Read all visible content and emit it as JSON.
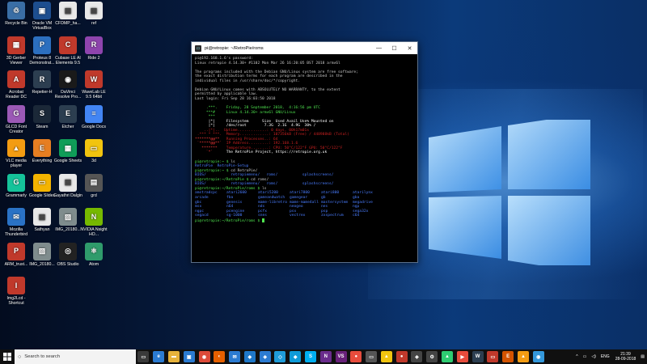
{
  "desktop_icons": [
    {
      "label": "Recycle Bin",
      "icon": "recycle-bin-icon",
      "color": "#3a6ea5",
      "glyph": "♲"
    },
    {
      "label": "Oracle VM VirtualBox",
      "icon": "virtualbox-icon",
      "color": "#1d4e8f",
      "glyph": "▣"
    },
    {
      "label": "CFDMP_ha...",
      "icon": "file-icon",
      "color": "#e8e8e8",
      "glyph": "▤"
    },
    {
      "label": "ref",
      "icon": "file-icon",
      "color": "#e8e8e8",
      "glyph": "▤"
    },
    {
      "label": "3D Gerber Viewer",
      "icon": "gerber-icon",
      "color": "#c0392b",
      "glyph": "▦"
    },
    {
      "label": "Proteus 8 Demonstrat...",
      "icon": "proteus-icon",
      "color": "#2c6fbf",
      "glyph": "P"
    },
    {
      "label": "Cubase LE AI Elements 9.5",
      "icon": "cubase-icon",
      "color": "#c0392b",
      "glyph": "C"
    },
    {
      "label": "Ride 2",
      "icon": "ride-icon",
      "color": "#8e44ad",
      "glyph": "R"
    },
    {
      "label": "Acrobat Reader DC",
      "icon": "acrobat-icon",
      "color": "#c0392b",
      "glyph": "A"
    },
    {
      "label": "Repetier-H",
      "icon": "repetier-icon",
      "color": "#2c3e50",
      "glyph": "R"
    },
    {
      "label": "DaVinci Resolve Pro...",
      "icon": "davinci-icon",
      "color": "#1a1a1a",
      "glyph": "◉"
    },
    {
      "label": "WaveLab LE 9.5 64bit",
      "icon": "wavelab-icon",
      "color": "#c0392b",
      "glyph": "W"
    },
    {
      "label": "GLCD Font Creator",
      "icon": "glcd-icon",
      "color": "#9b59b6",
      "glyph": "G"
    },
    {
      "label": "Steam",
      "icon": "steam-icon",
      "color": "#1b2838",
      "glyph": "S"
    },
    {
      "label": "Etcher",
      "icon": "etcher-icon",
      "color": "#2c3e50",
      "glyph": "E"
    },
    {
      "label": "Google Docs",
      "icon": "google-docs-icon",
      "color": "#4285f4",
      "glyph": "≡"
    },
    {
      "label": "VLC media player",
      "icon": "vlc-icon",
      "color": "#f39c12",
      "glyph": "▲"
    },
    {
      "label": "Everything",
      "icon": "everything-icon",
      "color": "#e67e22",
      "glyph": "E"
    },
    {
      "label": "Google Sheets",
      "icon": "google-sheets-icon",
      "color": "#0f9d58",
      "glyph": "▦"
    },
    {
      "label": "3d",
      "icon": "folder-icon",
      "color": "#f1c40f",
      "glyph": "▭"
    },
    {
      "label": "Grammarly",
      "icon": "grammarly-icon",
      "color": "#15c39a",
      "glyph": "G"
    },
    {
      "label": "Google Slides",
      "icon": "google-slides-icon",
      "color": "#f4b400",
      "glyph": "▭"
    },
    {
      "label": "Gayathri Dalgin",
      "icon": "file-icon",
      "color": "#e8e8e8",
      "glyph": "▤"
    },
    {
      "label": "grd",
      "icon": "grd-icon",
      "color": "#555555",
      "glyph": "▤"
    },
    {
      "label": "Mozilla Thunderbird",
      "icon": "thunderbird-icon",
      "color": "#2a72c5",
      "glyph": "✉"
    },
    {
      "label": "Sathyan",
      "icon": "file-icon",
      "color": "#e8e8e8",
      "glyph": "▤"
    },
    {
      "label": "IMG_20180...",
      "icon": "image-file-icon",
      "color": "#7f8c8d",
      "glyph": "▨"
    },
    {
      "label": "NVIDIA Nsight HO...",
      "icon": "nvidia-icon",
      "color": "#76b900",
      "glyph": "N"
    },
    {
      "label": "ARM_trust...",
      "icon": "pdf-icon",
      "color": "#c0392b",
      "glyph": "P"
    },
    {
      "label": "IMG_20180...",
      "icon": "image-file-icon",
      "color": "#7f8c8d",
      "glyph": "▨"
    },
    {
      "label": "OBS Studio",
      "icon": "obs-icon",
      "color": "#222222",
      "glyph": "◎"
    },
    {
      "label": "Atom",
      "icon": "atom-icon",
      "color": "#2f9b6b",
      "glyph": "⚛"
    },
    {
      "label": "Img2Lcd - Shortcut",
      "icon": "img2lcd-icon",
      "color": "#c0392b",
      "glyph": "I"
    }
  ],
  "terminal": {
    "title": "pi@retropie: ~/RetroPie/roms",
    "lines": {
      "l1": "pi@192.168.1.6's password:",
      "l2": "Linux retropie 4.14.30+ #1102 Mon Mar 26 16:20:05 BST 2018 armv6l",
      "l3": "The programs included with the Debian GNU/Linux system are free software;",
      "l4": "the exact distribution terms for each program are described in the",
      "l5": "individual files in /usr/share/doc/*/copyright.",
      "l6": "Debian GNU/Linux comes with ABSOLUTELY NO WARRANTY, to the extent",
      "l7": "permitted by applicable law.",
      "l8": "Last login: Fri Sep 28 16:03:50 2018",
      "b1": "Friday, 28 September 2018,  4:16:56 pm UTC",
      "b2": "Linux 4.14.30+ armv6l GNU/Linux",
      "b3": "Filesystem      Size  Used Avail Use% Mounted on",
      "b4": "/dev/root        7.3G  2.1G  4.9G  30% /",
      "b5": "Uptime.............: 0 days, 00h17m01s",
      "b6": "Memory.............: 107356kB (Free) / 448988kB (Total)",
      "b7": "Running Processes..: 64",
      "b8": "IP Address.........: 192.168.1.6",
      "b9": "Temperature........: CPU: 50°C/122°F GPU: 50°C/122°F",
      "b10": "The RetroPie Project, https://retropie.org.uk",
      "c1_prompt": "pi@retropie:~ $",
      "c1_cmd": " ls",
      "c1_out": "RetroPie  RetroPie-Setup",
      "c2_prompt": "pi@retropie:~ $",
      "c2_cmd": " cd RetroPie/",
      "c3_prompt": "pi@retropie:~/RetroPie $",
      "c3_cmd": " cd roms/",
      "c4_prompt": "pi@retropie:~/RetroPie/roms $",
      "c4_cmd": " ls",
      "c5_prompt": "pi@retropie:~/RetroPie/roms $"
    },
    "ls_repeat": [
      "BIOS/",
      "retropiemenu/",
      "roms/",
      "splashscreens/"
    ],
    "roms": [
      "amstradcpc",
      "atari2600",
      "atari5200",
      "atari7800",
      "atari800",
      "atarilynx",
      "arcade",
      "fba",
      "gameandwatch",
      "gamegear",
      "gb",
      "gba",
      "gbc",
      "genesis",
      "mame-libretro",
      "mame-mame4all",
      "mastersystem",
      "megadrive",
      "msx",
      "n64",
      "nds",
      "neogeo",
      "nes",
      "ngp",
      "ngpc",
      "pcengine",
      "pcfx",
      "psx",
      "psp",
      "sega32x",
      "segacd",
      "sg-1000",
      "snes",
      "vectrex",
      "zxspectrum",
      "c64"
    ]
  },
  "taskbar": {
    "search_placeholder": "Search to search",
    "apps": [
      {
        "name": "task-view-icon",
        "color": "#3a3a3a",
        "glyph": "▭"
      },
      {
        "name": "edge-icon",
        "color": "#2b7bd1",
        "glyph": "e"
      },
      {
        "name": "file-explorer-icon",
        "color": "#e6b23a",
        "glyph": "▬"
      },
      {
        "name": "store-icon",
        "color": "#2b7bd1",
        "glyph": "▣"
      },
      {
        "name": "chrome-icon",
        "color": "#dd4b39",
        "glyph": "◉"
      },
      {
        "name": "firefox-icon",
        "color": "#e66000",
        "glyph": "◐"
      },
      {
        "name": "mail-icon",
        "color": "#2b7bd1",
        "glyph": "✉"
      },
      {
        "name": "vscode-icon",
        "color": "#1f78c8",
        "glyph": "◆"
      },
      {
        "name": "app-icon",
        "color": "#2b7bd1",
        "glyph": "◈"
      },
      {
        "name": "app-icon",
        "color": "#1f9cd8",
        "glyph": "◇"
      },
      {
        "name": "app-icon",
        "color": "#0e9bd8",
        "glyph": "◆"
      },
      {
        "name": "skype-icon",
        "color": "#00aff0",
        "glyph": "S"
      },
      {
        "name": "app-icon",
        "color": "#6a2c8c",
        "glyph": "N"
      },
      {
        "name": "visual-studio-icon",
        "color": "#68217a",
        "glyph": "VS"
      },
      {
        "name": "app-icon",
        "color": "#e74c3c",
        "glyph": "●"
      },
      {
        "name": "putty-icon",
        "color": "#555555",
        "glyph": "▭"
      },
      {
        "name": "app-icon",
        "color": "#f1c40f",
        "glyph": "▲"
      },
      {
        "name": "app-icon",
        "color": "#c0392b",
        "glyph": "●"
      },
      {
        "name": "app-icon",
        "color": "#444444",
        "glyph": "◈"
      },
      {
        "name": "app-icon",
        "color": "#444444",
        "glyph": "⚙"
      },
      {
        "name": "app-icon",
        "color": "#2ecc71",
        "glyph": "▲"
      },
      {
        "name": "app-icon",
        "color": "#e74c3c",
        "glyph": "▶"
      },
      {
        "name": "app-icon",
        "color": "#2c3e50",
        "glyph": "W"
      },
      {
        "name": "app-icon",
        "color": "#c0392b",
        "glyph": "▭"
      },
      {
        "name": "app-icon",
        "color": "#d35400",
        "glyph": "E"
      },
      {
        "name": "app-icon",
        "color": "#f39c12",
        "glyph": "▲"
      },
      {
        "name": "app-icon",
        "color": "#3498db",
        "glyph": "◉"
      }
    ],
    "tray_lang": "ENG",
    "time": "21:39",
    "date": "28-09-2018"
  },
  "colors": {
    "prompt_green": "#4fe34f",
    "dir_blue": "#4a7dff",
    "logo_red": "#ff3b3b"
  }
}
